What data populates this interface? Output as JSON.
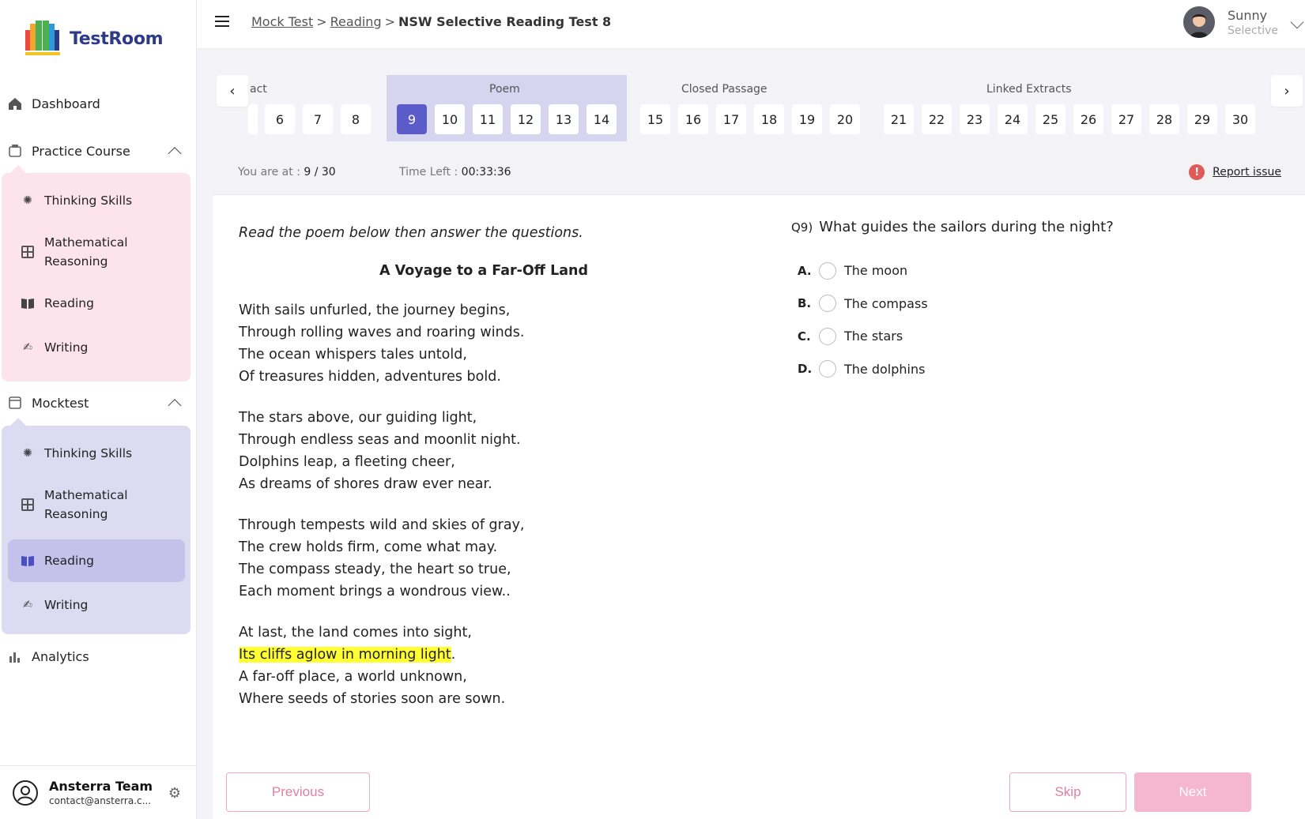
{
  "app": {
    "logo_text": "TestRoom",
    "colors": {
      "brand": "#2d3a8c",
      "accent": "#5b5bc9",
      "pink": "#fde4ec",
      "lavender": "#dcdbf1",
      "highlight": "#ffff33",
      "button": "#e07fa3"
    }
  },
  "sidebar": {
    "dashboard": {
      "label": "Dashboard",
      "icon": "home-icon"
    },
    "practice": {
      "label": "Practice Course",
      "icon": "practice-icon",
      "items": [
        {
          "label": "Thinking Skills",
          "icon": "lightbulb-icon"
        },
        {
          "label": "Mathematical Reasoning",
          "icon": "calculator-icon"
        },
        {
          "label": "Reading",
          "icon": "book-icon"
        },
        {
          "label": "Writing",
          "icon": "writing-hand-icon"
        }
      ]
    },
    "mocktest": {
      "label": "Mocktest",
      "icon": "mocktest-icon",
      "items": [
        {
          "label": "Thinking Skills",
          "icon": "lightbulb-icon"
        },
        {
          "label": "Mathematical Reasoning",
          "icon": "calculator-icon"
        },
        {
          "label": "Reading",
          "icon": "book-icon",
          "active": true
        },
        {
          "label": "Writing",
          "icon": "writing-hand-icon"
        }
      ]
    },
    "analytics": {
      "label": "Analytics",
      "icon": "bar-chart-icon"
    },
    "footer": {
      "name": "Ansterra Team",
      "email": "contact@ansterra.c..."
    }
  },
  "header": {
    "breadcrumb": [
      {
        "label": "Mock Test"
      },
      {
        "label": "Reading"
      },
      {
        "label": "NSW Selective Reading Test 8"
      }
    ],
    "breadcrumb_sep": ">",
    "user": {
      "name": "Sunny",
      "role": "Selective"
    }
  },
  "question_nav": {
    "sections": [
      "act",
      "Poem",
      "Closed Passage",
      "Linked Extracts"
    ],
    "numbers": [
      "6",
      "7",
      "8",
      "9",
      "10",
      "11",
      "12",
      "13",
      "14",
      "15",
      "16",
      "17",
      "18",
      "19",
      "20",
      "21",
      "22",
      "23",
      "24",
      "25",
      "26",
      "27",
      "28",
      "29",
      "30"
    ],
    "current": "9"
  },
  "status": {
    "position_label": "You are at :",
    "position_value": "9 / 30",
    "time_label": "Time Left :",
    "time_value": "00:33:36",
    "report_label": "Report issue",
    "report_icon": "!"
  },
  "passage": {
    "instruction": "Read the poem below then answer the questions.",
    "title": "A Voyage to a Far-Off Land",
    "stanzas": [
      [
        "With sails unfurled, the journey begins,",
        "Through rolling waves and roaring winds.",
        "The ocean whispers tales untold,",
        "Of treasures hidden, adventures bold."
      ],
      [
        "The stars above, our guiding light,",
        "Through endless seas and moonlit night.",
        "Dolphins leap, a fleeting cheer,",
        "As dreams of shores draw ever near."
      ],
      [
        "Through tempests wild and skies of gray,",
        "The crew holds firm, come what may.",
        "The compass steady, the heart so true,",
        "Each moment brings a wondrous view.."
      ],
      [
        "At last, the land comes into sight,",
        "Its cliffs aglow in morning light",
        "A far-off place, a world unknown,",
        "Where seeds of stories soon are sown."
      ]
    ],
    "highlight_suffix": "."
  },
  "question": {
    "number": "Q9)",
    "text": "What guides the sailors during the night?",
    "options": [
      {
        "letter": "A.",
        "text": "The moon"
      },
      {
        "letter": "B.",
        "text": "The compass"
      },
      {
        "letter": "C.",
        "text": "The stars"
      },
      {
        "letter": "D.",
        "text": "The dolphins"
      }
    ]
  },
  "buttons": {
    "previous": "Previous",
    "skip": "Skip",
    "next": "Next"
  }
}
